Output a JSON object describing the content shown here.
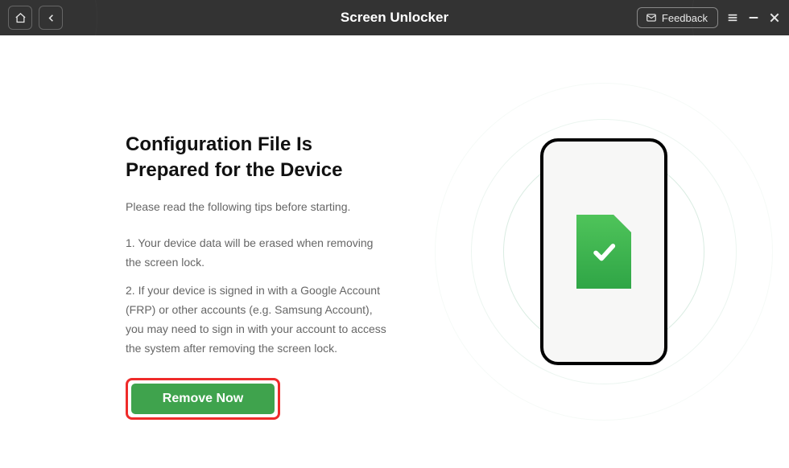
{
  "titlebar": {
    "title": "Screen Unlocker",
    "feedback_label": "Feedback"
  },
  "main": {
    "heading": "Configuration File Is Prepared for the Device",
    "subtitle": "Please read the following tips before starting.",
    "tip1": "1. Your device data will be erased when removing the screen lock.",
    "tip2": "2. If your device is signed in with a Google Account (FRP) or other accounts (e.g. Samsung Account), you may need to sign in with your account to access the system after removing the screen lock.",
    "remove_label": "Remove Now"
  },
  "colors": {
    "accent_green": "#3fa34d",
    "highlight_red": "#ef2b2a",
    "titlebar_bg": "#333333"
  }
}
